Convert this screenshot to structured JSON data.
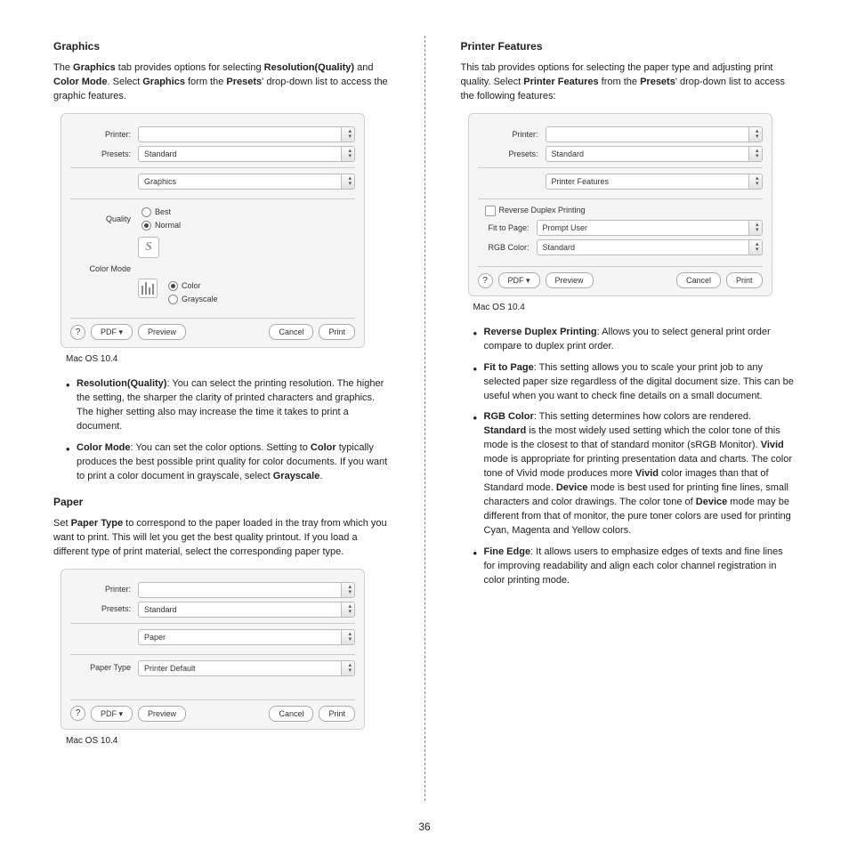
{
  "page_number": "36",
  "left": {
    "graphics": {
      "heading": "Graphics",
      "intro_1": "The ",
      "intro_b1": "Graphics",
      "intro_2": " tab provides options for selecting ",
      "intro_b2": "Resolution(Quality)",
      "intro_3": " and ",
      "intro_b3": "Color Mode",
      "intro_4": ". Select ",
      "intro_b4": "Graphics",
      "intro_5": " form the ",
      "intro_b5": "Presets",
      "intro_6": "' drop-down list to access the graphic features.",
      "caption": "Mac OS 10.4",
      "bullet1_b": "Resolution(Quality)",
      "bullet1_t": ": You can select the printing resolution. The higher the setting, the sharper the clarity of printed characters and graphics. The higher setting also may increase the time it takes to print a document.",
      "bullet2_b": "Color Mode",
      "bullet2_t1": ": You can set the color options. Setting to ",
      "bullet2_b2": "Color",
      "bullet2_t2": " typically produces the best possible print quality for color documents. If you want to print a color document in grayscale, select ",
      "bullet2_b3": "Grayscale",
      "bullet2_t3": "."
    },
    "paper": {
      "heading": "Paper",
      "intro_1": "Set ",
      "intro_b1": "Paper Type",
      "intro_2": " to correspond to the paper loaded in the tray from which you want to print. This will let you get the best quality printout. If you load a different type of print material, select the corresponding paper type.",
      "caption": "Mac OS 10.4"
    }
  },
  "right": {
    "heading": "Printer Features",
    "intro_1": "This tab provides options for selecting the paper type and adjusting print quality. Select ",
    "intro_b1": "Printer Features",
    "intro_2": " from the ",
    "intro_b2": "Presets",
    "intro_3": "' drop-down list to access the following features:",
    "caption": "Mac OS 10.4",
    "b1_b": "Reverse Duplex Printing",
    "b1_t": ": Allows you to select general print order compare to duplex print order.",
    "b2_b": "Fit to Page",
    "b2_t": ": This setting allows you to scale your print job to any selected paper size regardless of the digital document size. This can be useful when you want to check fine details on a small document.",
    "b3_b": "RGB Color",
    "b3_t1": ": This setting determines how colors are rendered. ",
    "b3_b2": "Standard",
    "b3_t2": " is the most widely used setting which the color tone of this mode is the closest to that of standard monitor (sRGB Monitor). ",
    "b3_b3": "Vivid",
    "b3_t3": " mode is appropriate for printing presentation data and charts. The color tone of Vivid mode produces more ",
    "b3_b4": "Vivid",
    "b3_t4": " color images than that of Standard mode. ",
    "b3_b5": "Device",
    "b3_t5": " mode is best used for printing fine lines, small characters and color drawings. The color tone of ",
    "b3_b6": "Device",
    "b3_t6": " mode may be different from that of monitor, the pure toner colors are used for printing Cyan, Magenta and Yellow colors.",
    "b4_b": "Fine Edge",
    "b4_t": ": It allows users to emphasize edges of texts and fine lines for improving readability and align each color channel registration in color printing mode."
  },
  "dlg": {
    "printer": "Printer:",
    "presets": "Presets:",
    "standard": "Standard",
    "graphics": "Graphics",
    "paper": "Paper",
    "printer_features": "Printer Features",
    "quality": "Quality",
    "best": "Best",
    "normal": "Normal",
    "color_mode": "Color Mode",
    "color": "Color",
    "grayscale": "Grayscale",
    "paper_type": "Paper Type",
    "printer_default": "Printer Default",
    "reverse_duplex": "Reverse Duplex Printing",
    "fit_to_page": "Fit to Page:",
    "prompt_user": "Prompt User",
    "rgb_color": "RGB Color:",
    "pdf": "PDF ▾",
    "preview": "Preview",
    "cancel": "Cancel",
    "print": "Print",
    "help": "?"
  }
}
